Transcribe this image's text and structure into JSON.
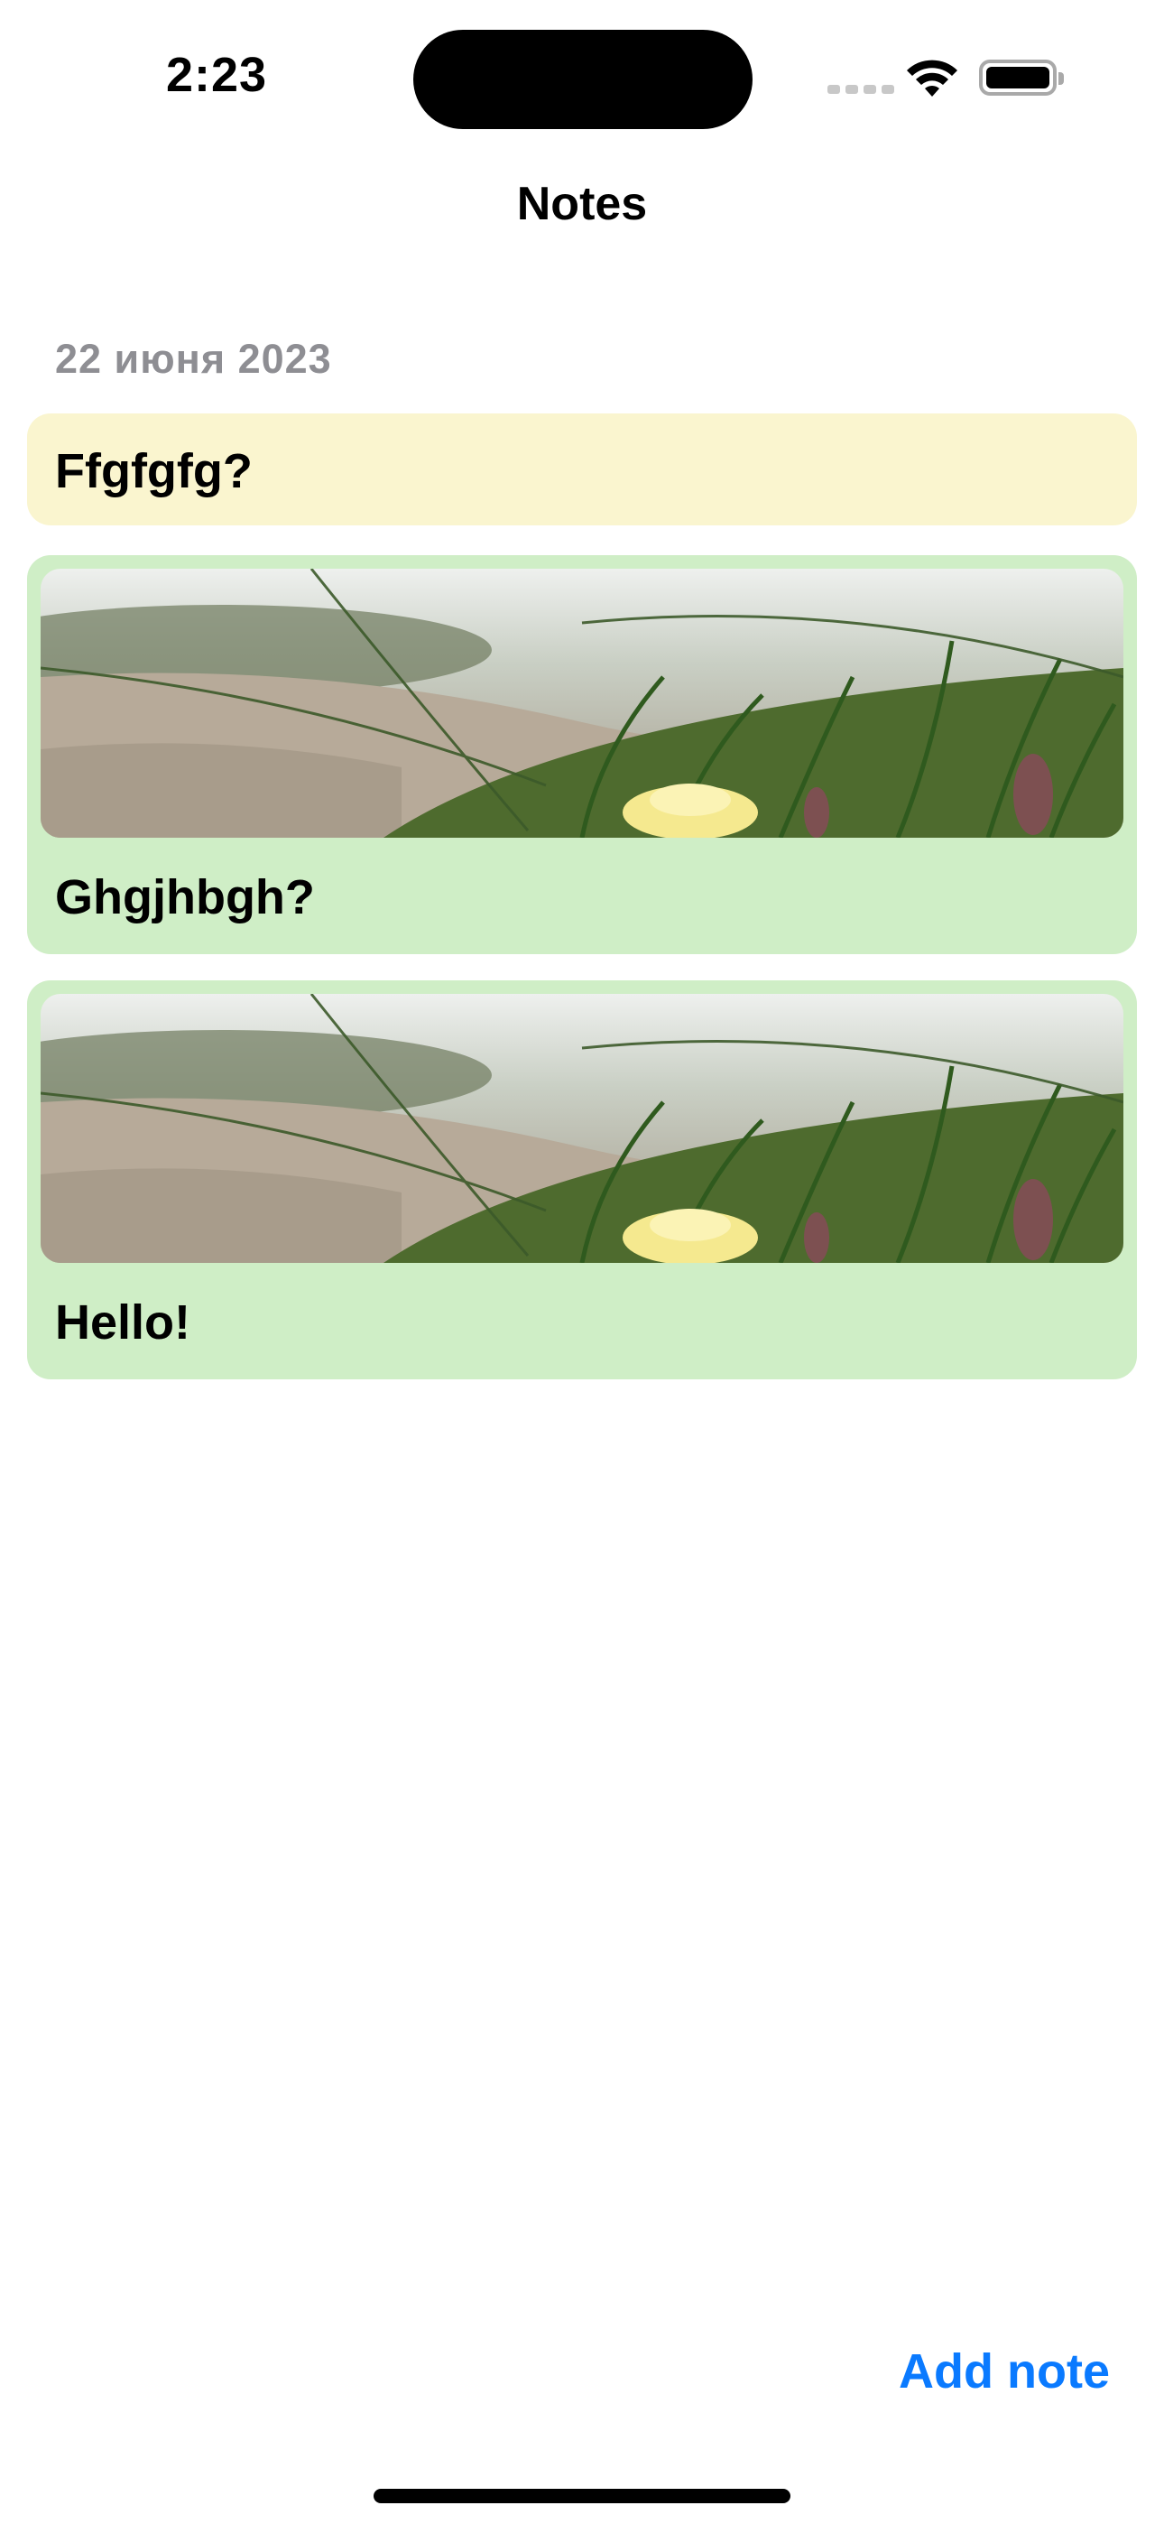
{
  "status_bar": {
    "time": "2:23",
    "icons": [
      "cellular-signal-icon",
      "wifi-icon",
      "battery-icon"
    ]
  },
  "nav": {
    "title": "Notes"
  },
  "section": {
    "date": "22  июня 2023"
  },
  "notes": [
    {
      "title": "Ffgfgfg?",
      "color": "#faf5cf",
      "has_image": false
    },
    {
      "title": "Ghgjhbgh?",
      "color": "#cfeec6",
      "has_image": true
    },
    {
      "title": "Hello!",
      "color": "#cfeec6",
      "has_image": true
    }
  ],
  "actions": {
    "add_note": "Add note"
  },
  "colors": {
    "accent": "#0a7aff",
    "secondary_text": "#8e8e93"
  }
}
